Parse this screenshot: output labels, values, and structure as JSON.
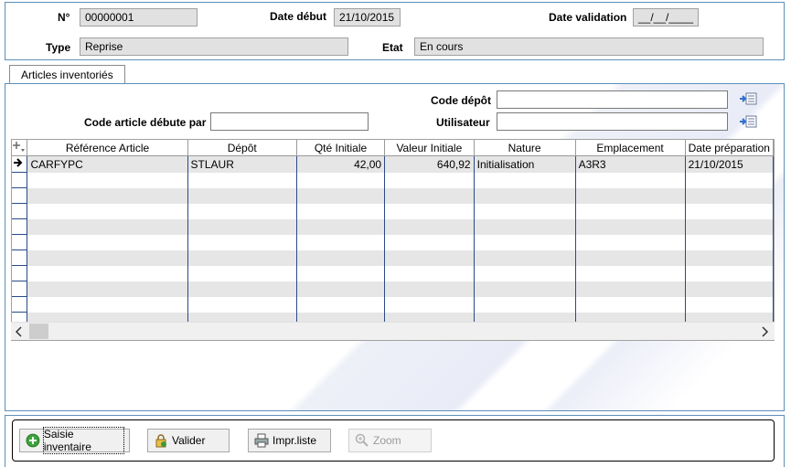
{
  "header": {
    "num_label": "N°",
    "num_value": "00000001",
    "date_debut_label": "Date début",
    "date_debut_value": "21/10/2015",
    "date_validation_label": "Date validation",
    "date_validation_value": "__/__/____",
    "type_label": "Type",
    "type_value": "Reprise",
    "etat_label": "Etat",
    "etat_value": "En cours"
  },
  "tab": {
    "label": "Articles inventoriés"
  },
  "filters": {
    "code_depot_label": "Code dépôt",
    "code_depot_value": "",
    "code_article_label": "Code article débute par",
    "code_article_value": "",
    "utilisateur_label": "Utilisateur",
    "utilisateur_value": ""
  },
  "grid": {
    "columns": [
      "Référence Article",
      "Dépôt",
      "Qté Initiale",
      "Valeur Initiale",
      "Nature",
      "Emplacement",
      "Date préparation"
    ],
    "rows": [
      [
        "CARFYPC",
        "STLAUR",
        "42,00",
        "640,92",
        "Initialisation",
        "A3R3",
        "21/10/2015"
      ],
      [
        "",
        "",
        "",
        "",
        "",
        "",
        ""
      ],
      [
        "",
        "",
        "",
        "",
        "",
        "",
        ""
      ],
      [
        "",
        "",
        "",
        "",
        "",
        "",
        ""
      ],
      [
        "",
        "",
        "",
        "",
        "",
        "",
        ""
      ],
      [
        "",
        "",
        "",
        "",
        "",
        "",
        ""
      ],
      [
        "",
        "",
        "",
        "",
        "",
        "",
        ""
      ],
      [
        "",
        "",
        "",
        "",
        "",
        "",
        ""
      ],
      [
        "",
        "",
        "",
        "",
        "",
        "",
        ""
      ],
      [
        "",
        "",
        "",
        "",
        "",
        "",
        ""
      ],
      [
        "",
        "",
        "",
        "",
        "",
        "",
        ""
      ]
    ]
  },
  "buttons": {
    "saisie": "Saisie inventaire",
    "valider": "Valider",
    "impr": "Impr.liste",
    "zoom": "Zoom"
  },
  "colors": {
    "frame": "#5b8fb9",
    "grid_line": "#2a4a8a",
    "readonly_bg": "#e1e1e1"
  }
}
